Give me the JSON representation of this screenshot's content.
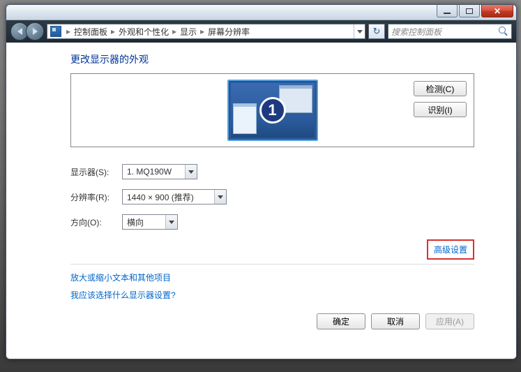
{
  "breadcrumb": {
    "root": "控制面板",
    "level2": "外观和个性化",
    "level3": "显示",
    "level4": "屏幕分辨率"
  },
  "search": {
    "placeholder": "搜索控制面板"
  },
  "page": {
    "title": "更改显示器的外观",
    "detect_btn": "检测(C)",
    "identify_btn": "识别(I)",
    "monitor_number": "1"
  },
  "form": {
    "display_label": "显示器(S):",
    "display_value": "1. MQ190W",
    "resolution_label": "分辨率(R):",
    "resolution_value": "1440 × 900 (推荐)",
    "orientation_label": "方向(O):",
    "orientation_value": "横向"
  },
  "links": {
    "advanced": "高级设置",
    "text_size": "放大或缩小文本和其他项目",
    "which_display": "我应该选择什么显示器设置?"
  },
  "actions": {
    "ok": "确定",
    "cancel": "取消",
    "apply": "应用(A)"
  }
}
